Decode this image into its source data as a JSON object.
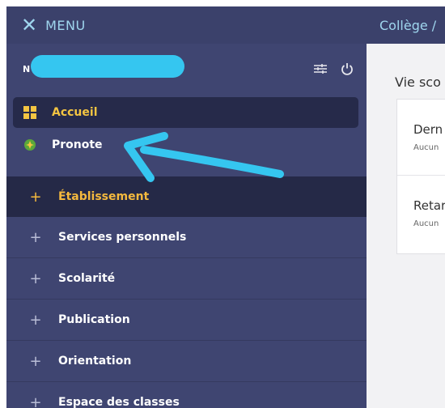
{
  "header": {
    "menu_label": "MENU",
    "school_name": "Collège /"
  },
  "user": {
    "name_initial": "N"
  },
  "quick_links": [
    {
      "label": "Accueil",
      "icon": "grid-icon",
      "active": true
    },
    {
      "label": "Pronote",
      "icon": "pronote-icon",
      "active": false
    }
  ],
  "sections": [
    {
      "label": "Établissement",
      "open": true
    },
    {
      "label": "Services personnels"
    },
    {
      "label": "Scolarité"
    },
    {
      "label": "Publication"
    },
    {
      "label": "Orientation"
    },
    {
      "label": "Espace des classes"
    }
  ],
  "main": {
    "title": "Vie sco",
    "cards": [
      {
        "title": "Dern",
        "subtitle": "Aucun"
      },
      {
        "title": "Retar",
        "subtitle": "Aucun"
      }
    ]
  },
  "colors": {
    "sidebar": "#3f4571",
    "accent": "#f4b93e",
    "header_text": "#9fd6ee",
    "annotation": "#35c6f0"
  }
}
